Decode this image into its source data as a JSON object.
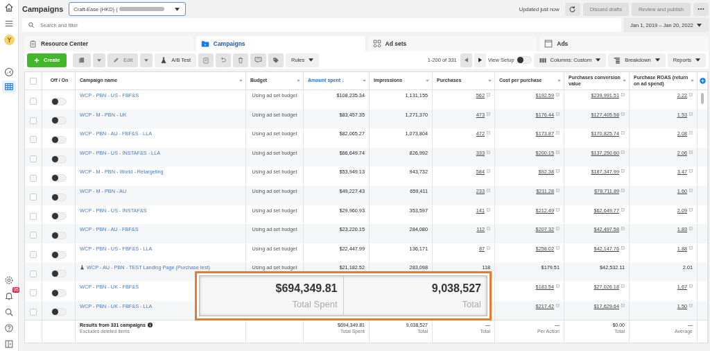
{
  "header": {
    "title": "Campaigns",
    "account": "Craft-Ease (HKD) (",
    "status": "Updated just now",
    "buttons": [
      {
        "label": "Discard drafts",
        "disabled": true
      },
      {
        "label": "Review and publish",
        "disabled": true
      }
    ]
  },
  "rail": {
    "badge": "95"
  },
  "search": {
    "placeholder": "Search and filter"
  },
  "date_range": "Jan 1, 2019 – Jan 20, 2022",
  "tabs": [
    {
      "label": "Resource Center",
      "selected": false
    },
    {
      "label": "Campaigns",
      "selected": true
    },
    {
      "label": "Ad sets",
      "selected": false
    },
    {
      "label": "Ads",
      "selected": false
    }
  ],
  "toolbar": {
    "create": "Create",
    "edit": {
      "label": "Edit",
      "disabled": true
    },
    "ab_test": "A/B Test",
    "rules": "Rules",
    "pagination": "1-200 of 331",
    "view_setup": {
      "label": "View Setup",
      "on": false
    },
    "columns": "Columns: Custom",
    "breakdown": "Breakdown",
    "reports": "Reports"
  },
  "table": {
    "select_all_checked": false,
    "columns": [
      {
        "label": "Off / On",
        "sorted": false
      },
      {
        "label": "Campaign name",
        "sorted": false
      },
      {
        "label": "Budget",
        "sorted": false
      },
      {
        "label": "Amount spent ↓",
        "sorted": true
      },
      {
        "label": "Impressions",
        "sorted": false
      },
      {
        "label": "Purchases",
        "sorted": false
      },
      {
        "label": "Cost per purchase",
        "sorted": false
      },
      {
        "label": "Purchases conversion value",
        "sorted": false
      },
      {
        "label": "Purchase ROAS (return on ad spend)",
        "sorted": false
      }
    ],
    "rows": [
      {
        "checked": false,
        "on": false,
        "test": false,
        "linked": true,
        "name": "WCP - PBN - US - FBF&S",
        "budget": "Using ad set budget",
        "amount": "$108,235.34",
        "impressions": "1,131,155",
        "purchases": "562",
        "cost": "$192.59",
        "value": "$239,991.51",
        "roas": "2.22"
      },
      {
        "checked": false,
        "on": false,
        "test": false,
        "linked": true,
        "name": "WCP - M - PBN - UK",
        "budget": "Using ad set budget",
        "amount": "$83,457.35",
        "impressions": "1,271,370",
        "purchases": "473",
        "cost": "$176.44",
        "value": "$127,405.58",
        "roas": "1.53"
      },
      {
        "checked": false,
        "on": false,
        "test": false,
        "linked": true,
        "name": "WCP - PBN - AU - FBF&S - LLA",
        "budget": "Using ad set budget",
        "amount": "$82,065.27",
        "impressions": "1,073,804",
        "purchases": "472",
        "cost": "$173.87",
        "value": "$170,825.74",
        "roas": "2.08"
      },
      {
        "checked": false,
        "on": false,
        "test": false,
        "linked": true,
        "name": "WCP - PBN - US - INSTAF&S - LLA",
        "budget": "Using ad set budget",
        "amount": "$66,649.74",
        "impressions": "826,992",
        "purchases": "333",
        "cost": "$200.15",
        "value": "$137,250.60",
        "roas": "2.06"
      },
      {
        "checked": false,
        "on": false,
        "test": false,
        "linked": true,
        "name": "WCP - M - PBN - World - Retargeting",
        "budget": "Using ad set budget",
        "amount": "$53,949.13",
        "impressions": "943,732",
        "purchases": "584",
        "cost": "$92.38",
        "value": "$187,347.99",
        "roas": "3.47"
      },
      {
        "checked": false,
        "on": false,
        "test": false,
        "linked": true,
        "name": "WCP - M - PBN - AU",
        "budget": "Using ad set budget",
        "amount": "$49,227.43",
        "impressions": "659,411",
        "purchases": "233",
        "cost": "$211.28",
        "value": "$78,711.89",
        "roas": "1.60"
      },
      {
        "checked": false,
        "on": false,
        "test": false,
        "linked": true,
        "name": "WCP - PBN - US - INSTAF&S",
        "budget": "Using ad set budget",
        "amount": "$29,960.93",
        "impressions": "353,597",
        "purchases": "141",
        "cost": "$212.49",
        "value": "$62,649.77",
        "roas": "2.09"
      },
      {
        "checked": false,
        "on": false,
        "test": false,
        "linked": true,
        "name": "WCP - PBN - AU - FBF&S",
        "budget": "Using ad set budget",
        "amount": "$23,220.15",
        "impressions": "284,080",
        "purchases": "112",
        "cost": "$207.32",
        "value": "$42,497.58",
        "roas": "1.83"
      },
      {
        "checked": false,
        "on": false,
        "test": false,
        "linked": true,
        "name": "WCP - PBN - US - FBF&S - LLA",
        "budget": "Using ad set budget",
        "amount": "$22,447.99",
        "impressions": "136,171",
        "purchases": "87",
        "cost": "$258.02",
        "value": "$42,147.76",
        "roas": "1.88"
      },
      {
        "checked": false,
        "on": false,
        "test": true,
        "linked": false,
        "name": "WCP - AU - PBN - TEST Landing Page (Purchase test)",
        "budget": "Using ad set budget",
        "amount": "$21,182.52",
        "impressions": "283,098",
        "purchases": "118",
        "cost": "$179.51",
        "value": "$42,532.11",
        "roas": "2.01"
      },
      {
        "checked": false,
        "on": false,
        "test": false,
        "linked": true,
        "name": "WCP - PBN - UK - FBF&S",
        "cost": "$183.54",
        "value": "$27,026.18",
        "roas": "1.67"
      },
      {
        "checked": false,
        "on": false,
        "test": false,
        "linked": true,
        "name": "WCP - PBN - UK - FBF&S - LLA",
        "cost": "$217.42",
        "value": "$17,629.64",
        "roas": "1.50"
      }
    ],
    "footer": {
      "title": "Results from 331 campaigns",
      "note": "Excludes deleted items",
      "totals": [
        {
          "value": "$694,349.81",
          "label": "Total Spent"
        },
        {
          "value": "9,038,527",
          "label": "Total"
        },
        {
          "value": "—",
          "label": "Total"
        },
        {
          "value": "—",
          "label": "Per Action"
        },
        {
          "value": "$0.00",
          "label": "Total"
        },
        {
          "value": "—",
          "label": "Average"
        }
      ]
    }
  },
  "callout": [
    {
      "value": "$694,349.81",
      "label": "Total Spent"
    },
    {
      "value": "9,038,527",
      "label": "Total"
    }
  ]
}
